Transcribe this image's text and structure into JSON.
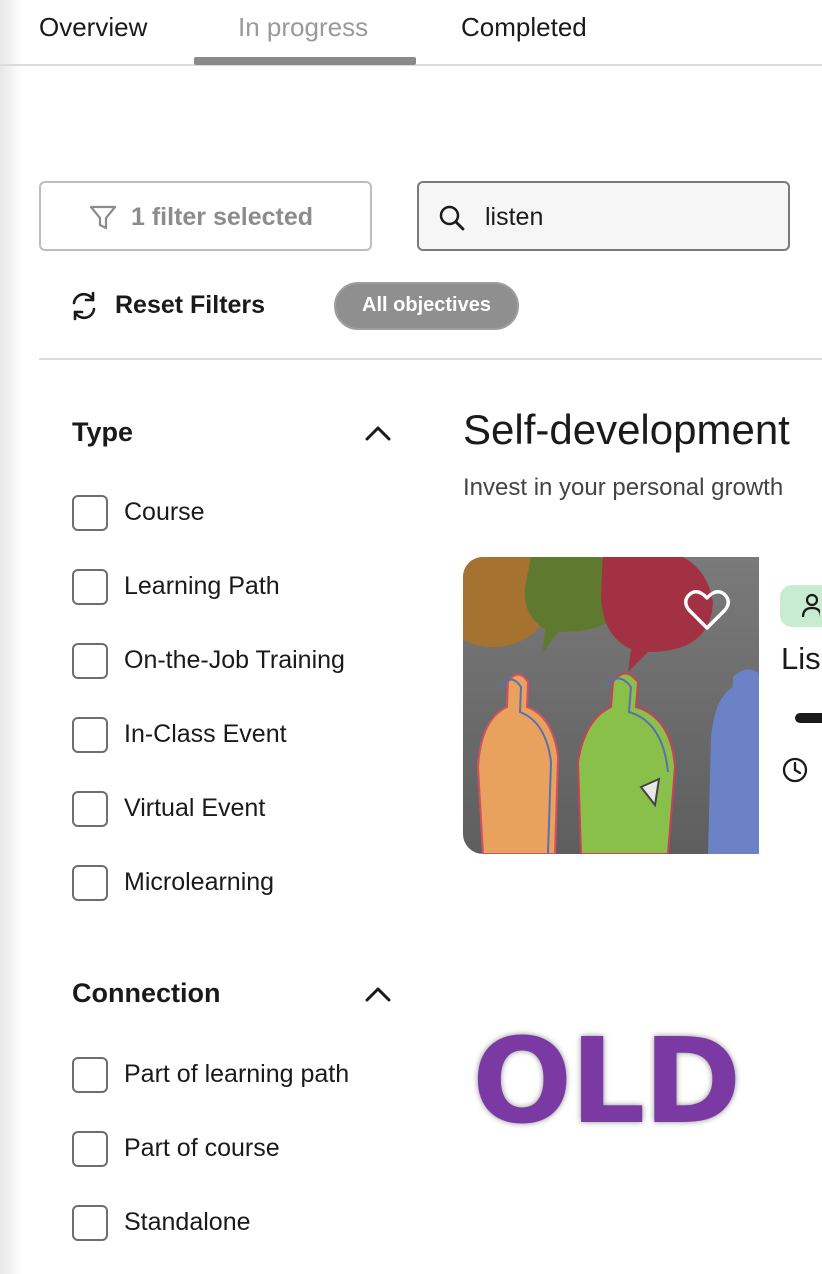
{
  "tabs": [
    {
      "label": "Overview"
    },
    {
      "label": "In progress"
    },
    {
      "label": "Completed"
    }
  ],
  "active_tab": "In progress",
  "filter_button": {
    "label": "1 filter selected",
    "icon": "filter-icon"
  },
  "search": {
    "value": "listen",
    "icon": "search-icon"
  },
  "reset_filters": {
    "label": "Reset Filters",
    "icon": "refresh-icon"
  },
  "objective_pill": {
    "label": "All objectives"
  },
  "sidebar": {
    "type_section": {
      "title": "Type",
      "options": [
        {
          "label": "Course",
          "checked": false
        },
        {
          "label": "Learning Path",
          "checked": false
        },
        {
          "label": "On-the-Job Training",
          "checked": false
        },
        {
          "label": "In-Class Event",
          "checked": false
        },
        {
          "label": "Virtual Event",
          "checked": false
        },
        {
          "label": "Microlearning",
          "checked": false
        }
      ]
    },
    "connection_section": {
      "title": "Connection",
      "options": [
        {
          "label": "Part of learning path",
          "checked": false
        },
        {
          "label": "Part of course",
          "checked": false
        },
        {
          "label": "Standalone",
          "checked": false
        }
      ]
    }
  },
  "main": {
    "title": "Self-development",
    "subtitle": "Invest in your personal growth",
    "card": {
      "title": "Lis",
      "favorite_icon": "heart-icon",
      "badge_icon": "person-icon",
      "duration_icon": "clock-icon"
    }
  },
  "stamp": {
    "text": "OLD"
  },
  "colors": {
    "stamp": "#7b3aa3",
    "badge": "#c7ecd2",
    "pill": "#8f8f8f"
  }
}
